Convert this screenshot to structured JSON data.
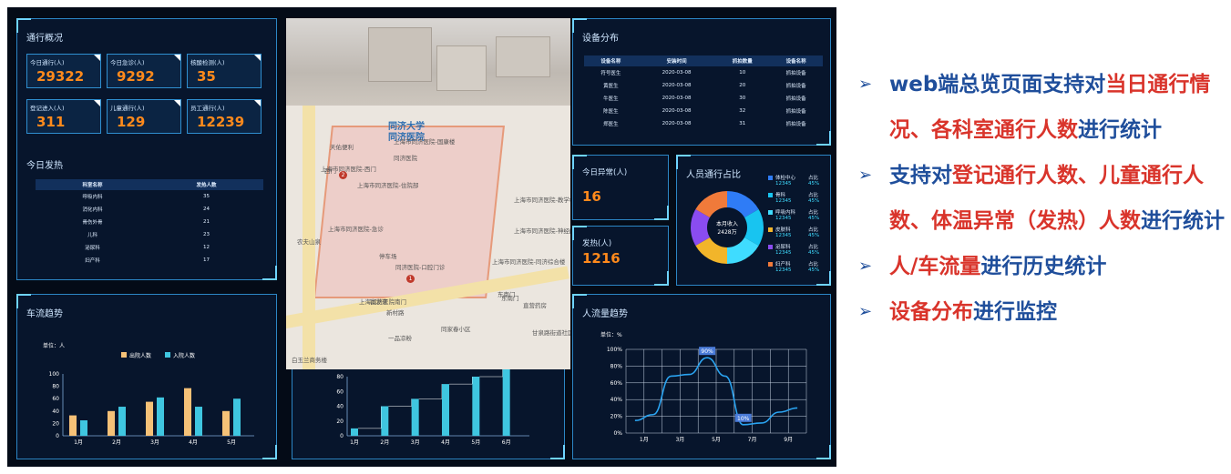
{
  "dashboard": {
    "traffic_overview": {
      "title": "通行概况",
      "kpis": [
        {
          "label": "今日通行(人)",
          "value": "29322"
        },
        {
          "label": "今日急诊(人)",
          "value": "9292"
        },
        {
          "label": "核酸检测(人)",
          "value": "35"
        },
        {
          "label": "登记进入(人)",
          "value": "311"
        },
        {
          "label": "儿童通行(人)",
          "value": "129"
        },
        {
          "label": "员工通行(人)",
          "value": "12239"
        }
      ],
      "fever_title": "今日发热",
      "fever_table": {
        "headers": [
          "科室名称",
          "发热人数"
        ],
        "rows": [
          [
            "呼吸内科",
            "35"
          ],
          [
            "消化内科",
            "24"
          ],
          [
            "骨伤外骨",
            "21"
          ],
          [
            "儿科",
            "23"
          ],
          [
            "泌尿科",
            "12"
          ],
          [
            "妇产科",
            "17"
          ]
        ]
      }
    },
    "device_distribution": {
      "title": "设备分布",
      "headers": [
        "设备名称",
        "安装时间",
        "抓拍数量",
        "设备名称"
      ],
      "rows": [
        [
          "符号医生",
          "2020-03-08",
          "10",
          "抓拍设备"
        ],
        [
          "黄医生",
          "2020-03-08",
          "20",
          "抓拍设备"
        ],
        [
          "牛医生",
          "2020-03-08",
          "30",
          "抓拍设备"
        ],
        [
          "陈医生",
          "2020-03-08",
          "32",
          "抓拍设备"
        ],
        [
          "郑医生",
          "2020-03-08",
          "31",
          "抓拍设备"
        ]
      ]
    },
    "today_abnormal": {
      "label": "今日异常(人)",
      "value": "16"
    },
    "fever_count": {
      "label": "发热(人)",
      "value": "1216"
    },
    "personnel_share": {
      "title": "人员通行占比",
      "center_line1": "本月收入",
      "center_line2": "2428万",
      "legend": [
        {
          "name": "体检中心",
          "ratio_label": "占比",
          "count": "12345",
          "percent": "45%",
          "color": "#2f7cf6"
        },
        {
          "name": "骨科",
          "ratio_label": "占比",
          "count": "12345",
          "percent": "45%",
          "color": "#18c4f0"
        },
        {
          "name": "呼吸内科",
          "ratio_label": "占比",
          "count": "12345",
          "percent": "45%",
          "color": "#3fdcff"
        },
        {
          "name": "皮肤科",
          "ratio_label": "占比",
          "count": "12345",
          "percent": "45%",
          "color": "#f2b52a"
        },
        {
          "name": "泌尿科",
          "ratio_label": "占比",
          "count": "12345",
          "percent": "45%",
          "color": "#8a4cf0"
        },
        {
          "name": "妇产科",
          "ratio_label": "占比",
          "count": "12345",
          "percent": "45%",
          "color": "#f07a3a"
        }
      ]
    },
    "car_flow": {
      "title": "车流趋势",
      "unit": "单位：人",
      "legend": [
        "出院人数",
        "入院人数"
      ],
      "colors": [
        "#f5c177",
        "#3fc6e0"
      ]
    },
    "middle_chart": {
      "color": "#3fc6e0"
    },
    "people_flow": {
      "title": "人流量趋势",
      "unit": "单位：%",
      "callout_high": "90%",
      "callout_low": "10%"
    }
  },
  "map": {
    "labels": [
      "同济大学",
      "同济医院",
      "上海市同济医院-西门",
      "天佑便利",
      "上海市同济医院-国康楼",
      "上海市同济医院-住院部",
      "上海市同济医院-急诊",
      "上海市同济医院-教学楼",
      "上海市同济医院-神经内科",
      "停车场",
      "同济医院-口腔门诊",
      "东南门",
      "新村路",
      "同济医院",
      "农夫山泉",
      "东南门",
      "富发来",
      "上海同济医院南门",
      "一品凉粉",
      "同家春小区",
      "上海市同济医院-同济综合楼",
      "甘泉路街道社区卫生服务中心",
      "直营药房",
      "白玉兰商务楼",
      "西门"
    ],
    "markers": [
      "2",
      "1"
    ]
  },
  "notes": [
    {
      "parts": [
        {
          "t": "web端总览页面支持对",
          "red": false
        },
        {
          "t": "当日通行情况、各科室通行人数",
          "red": true
        },
        {
          "t": "进行统计",
          "red": false
        }
      ]
    },
    {
      "parts": [
        {
          "t": "支持对",
          "red": false
        },
        {
          "t": "登记通行人数、儿童通行人数、体温异常（发热）人数",
          "red": true
        },
        {
          "t": "进行统计",
          "red": false
        }
      ]
    },
    {
      "parts": [
        {
          "t": "人/车流量",
          "red": true
        },
        {
          "t": "进行历史统计",
          "red": false
        }
      ]
    },
    {
      "parts": [
        {
          "t": "设备分布",
          "red": true
        },
        {
          "t": "进行监控",
          "red": false
        }
      ]
    }
  ],
  "chart_data": [
    {
      "type": "bar",
      "title": "车流趋势",
      "categories": [
        "1月",
        "2月",
        "3月",
        "4月",
        "5月"
      ],
      "series": [
        {
          "name": "出院人数",
          "values": [
            33,
            40,
            55,
            77,
            40
          ]
        },
        {
          "name": "入院人数",
          "values": [
            25,
            47,
            62,
            47,
            60
          ]
        }
      ],
      "ylabel": "单位：人",
      "ylim": [
        0,
        100
      ],
      "yticks": [
        "0",
        "20",
        "40",
        "60",
        "80",
        "100"
      ]
    },
    {
      "type": "bar",
      "categories": [
        "1月",
        "2月",
        "3月",
        "4月",
        "5月",
        "6月"
      ],
      "series": [
        {
          "values": [
            10,
            40,
            50,
            70,
            80,
            100
          ]
        }
      ],
      "ylim": [
        0,
        80
      ],
      "yticks": [
        "0",
        "20",
        "40",
        "60",
        "80"
      ]
    },
    {
      "type": "line",
      "title": "人流量趋势",
      "x": [
        "1月",
        "3月",
        "5月",
        "7月",
        "9月"
      ],
      "values": [
        15,
        22,
        68,
        70,
        90,
        68,
        10,
        12,
        25,
        30
      ],
      "ylabel": "单位：%",
      "ylim": [
        0,
        100
      ],
      "yticks": [
        "0%",
        "20%",
        "40%",
        "60%",
        "80%",
        "100%"
      ],
      "annotations": [
        "90%",
        "10%"
      ]
    }
  ]
}
